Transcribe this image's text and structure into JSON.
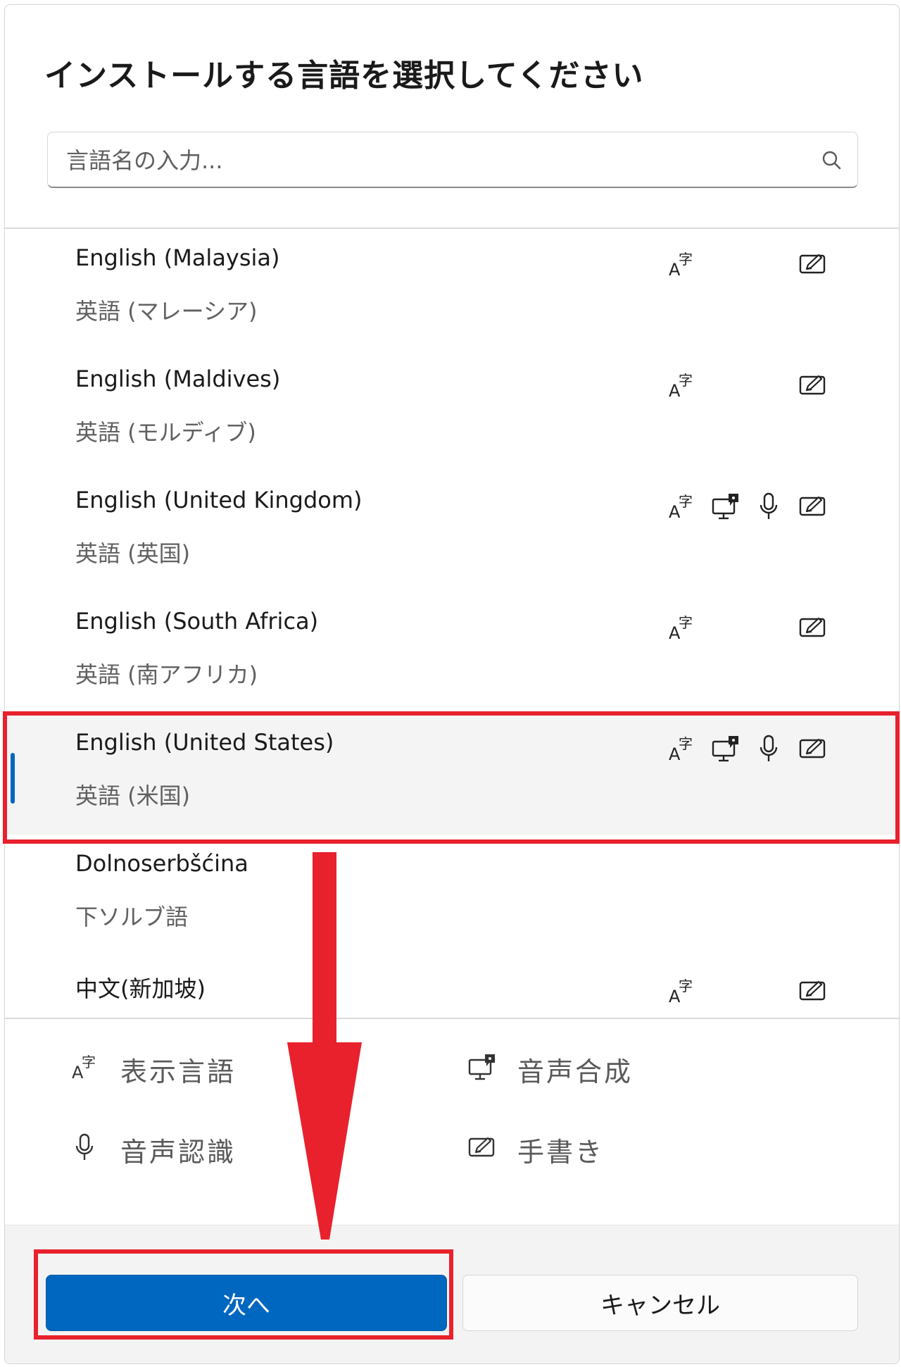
{
  "dialog": {
    "title": "インストールする言語を選択してください",
    "search": {
      "placeholder": "言語名の入力...",
      "value": ""
    }
  },
  "languages": [
    {
      "name": "English (Malaysia)",
      "native": "英語 (マレーシア)",
      "features": [
        "display-language",
        "handwriting"
      ],
      "selected": false
    },
    {
      "name": "English (Maldives)",
      "native": "英語 (モルディブ)",
      "features": [
        "display-language",
        "handwriting"
      ],
      "selected": false
    },
    {
      "name": "English (United Kingdom)",
      "native": "英語 (英国)",
      "features": [
        "display-language",
        "text-to-speech",
        "speech-recognition",
        "handwriting"
      ],
      "selected": false
    },
    {
      "name": "English (South Africa)",
      "native": "英語 (南アフリカ)",
      "features": [
        "display-language",
        "handwriting"
      ],
      "selected": false
    },
    {
      "name": "English (United States)",
      "native": "英語 (米国)",
      "features": [
        "display-language",
        "text-to-speech",
        "speech-recognition",
        "handwriting"
      ],
      "selected": true
    },
    {
      "name": "Dolnoserbšćina",
      "native": "下ソルブ語",
      "features": [],
      "selected": false
    },
    {
      "name": "中文(新加坡)",
      "native": "",
      "features": [
        "display-language",
        "handwriting"
      ],
      "selected": false
    }
  ],
  "legend": {
    "display_language": "表示言語",
    "text_to_speech": "音声合成",
    "speech_recognition": "音声認識",
    "handwriting": "手書き"
  },
  "buttons": {
    "next": "次へ",
    "cancel": "キャンセル"
  },
  "colors": {
    "accent": "#0067c0",
    "annotation": "#e8212d"
  }
}
